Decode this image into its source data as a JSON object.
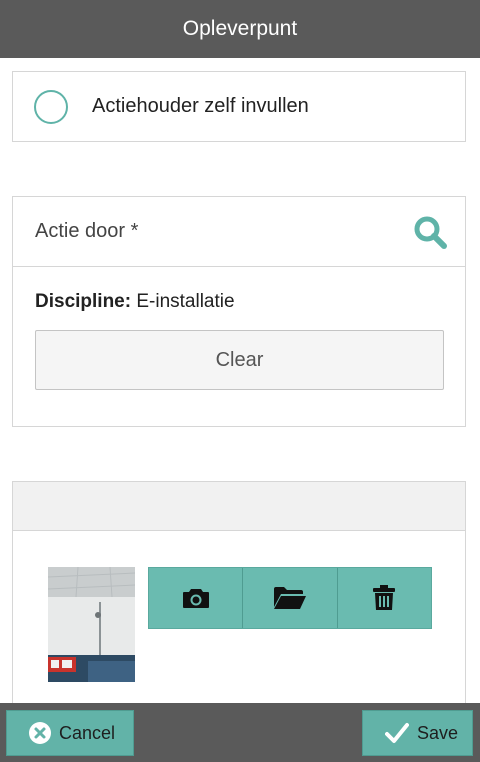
{
  "header": {
    "title": "Opleverpunt"
  },
  "radio_option": {
    "label": "Actiehouder zelf invullen"
  },
  "actie": {
    "label": "Actie door *",
    "discipline_label": "Discipline:",
    "discipline_value": "E-installatie",
    "clear_label": "Clear"
  },
  "photo_section": {
    "tools": [
      "camera-icon",
      "folder-icon",
      "trash-icon"
    ]
  },
  "footer": {
    "cancel_label": "Cancel",
    "save_label": "Save"
  },
  "colors": {
    "accent": "#62b3a8",
    "header_bg": "#5a5a5a"
  }
}
